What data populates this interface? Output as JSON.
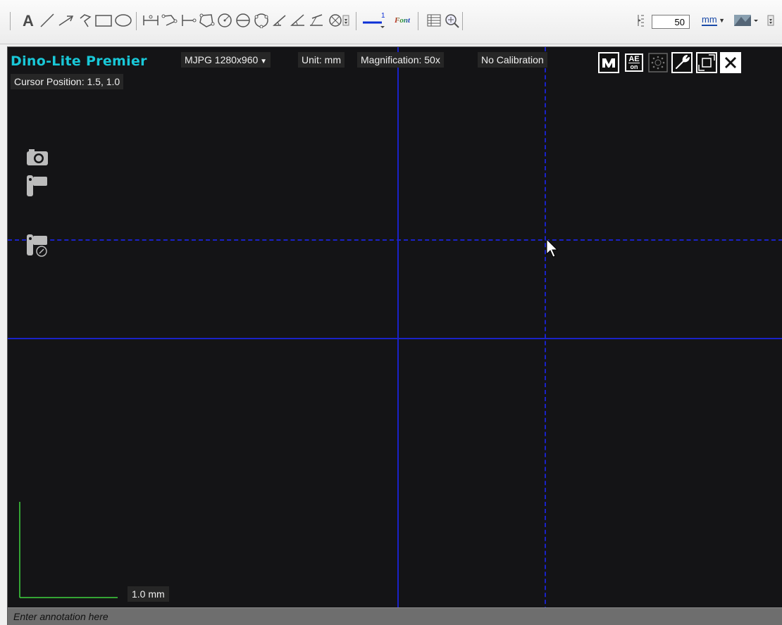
{
  "toolbar": {
    "tools": [
      {
        "name": "text-tool-icon"
      },
      {
        "name": "line-tool-icon"
      },
      {
        "name": "arrow-tool-icon"
      },
      {
        "name": "polyline-tool-icon"
      },
      {
        "name": "rectangle-tool-icon"
      },
      {
        "name": "ellipse-tool-icon"
      }
    ],
    "measure_tools": [
      {
        "name": "distance-tool-icon"
      },
      {
        "name": "polyline-length-icon"
      },
      {
        "name": "parallel-tool-icon"
      },
      {
        "name": "polygon-area-icon"
      },
      {
        "name": "circle-radius-icon"
      },
      {
        "name": "circle-diameter-icon"
      },
      {
        "name": "circle-3point-icon"
      },
      {
        "name": "angle-tool-icon"
      },
      {
        "name": "angle-3point-icon"
      },
      {
        "name": "angle-4point-icon"
      },
      {
        "name": "center-distance-icon"
      }
    ],
    "line_width_label": "1",
    "font_label": "Font",
    "zoom_value": "50",
    "unit_label": "mm",
    "colors": {
      "line_blue": "#0b2fd6",
      "accent": "#1a4aa8"
    }
  },
  "viewer": {
    "device_name": "Dino-Lite Premier",
    "resolution": "MJPG 1280x960",
    "unit": "Unit: mm",
    "magnification": "Magnification: 50x",
    "calibration": "No Calibration",
    "cursor_position": "Cursor Position: 1.5, 1.0",
    "scale_label": "1.0 mm",
    "annotation_placeholder": "Enter annotation here",
    "buttons": {
      "ae_top": "AE",
      "ae_bottom": "on"
    },
    "colors": {
      "device_name": "#19c8d8",
      "crosshair": "#1a22c8",
      "scale_bar": "#3fd43f",
      "background": "#141416"
    }
  }
}
